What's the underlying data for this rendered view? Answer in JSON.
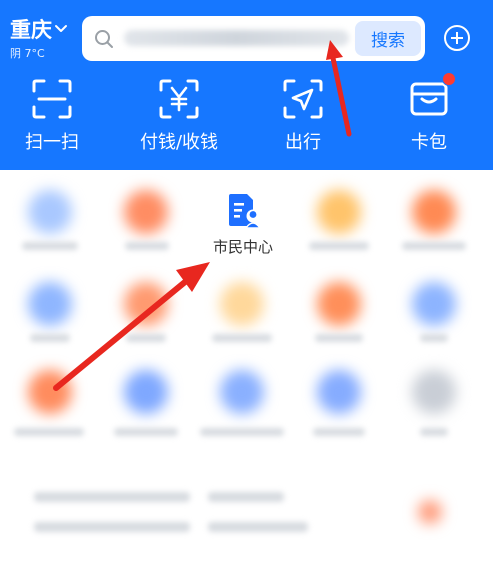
{
  "header": {
    "city": "重庆",
    "weather": "阴 7°C",
    "search": {
      "button_label": "搜索"
    }
  },
  "quick_actions": [
    {
      "label": "扫一扫",
      "icon": "scan-icon"
    },
    {
      "label": "付钱/收钱",
      "icon": "yuan-icon"
    },
    {
      "label": "出行",
      "icon": "travel-icon"
    },
    {
      "label": "卡包",
      "icon": "wallet-icon"
    }
  ],
  "apps": {
    "civic_center": {
      "label": "市民中心",
      "icon": "citizen-center-icon"
    }
  },
  "colors": {
    "brand": "#1677ff",
    "badge": "#ff3b30",
    "arrow": "#e8271f"
  }
}
